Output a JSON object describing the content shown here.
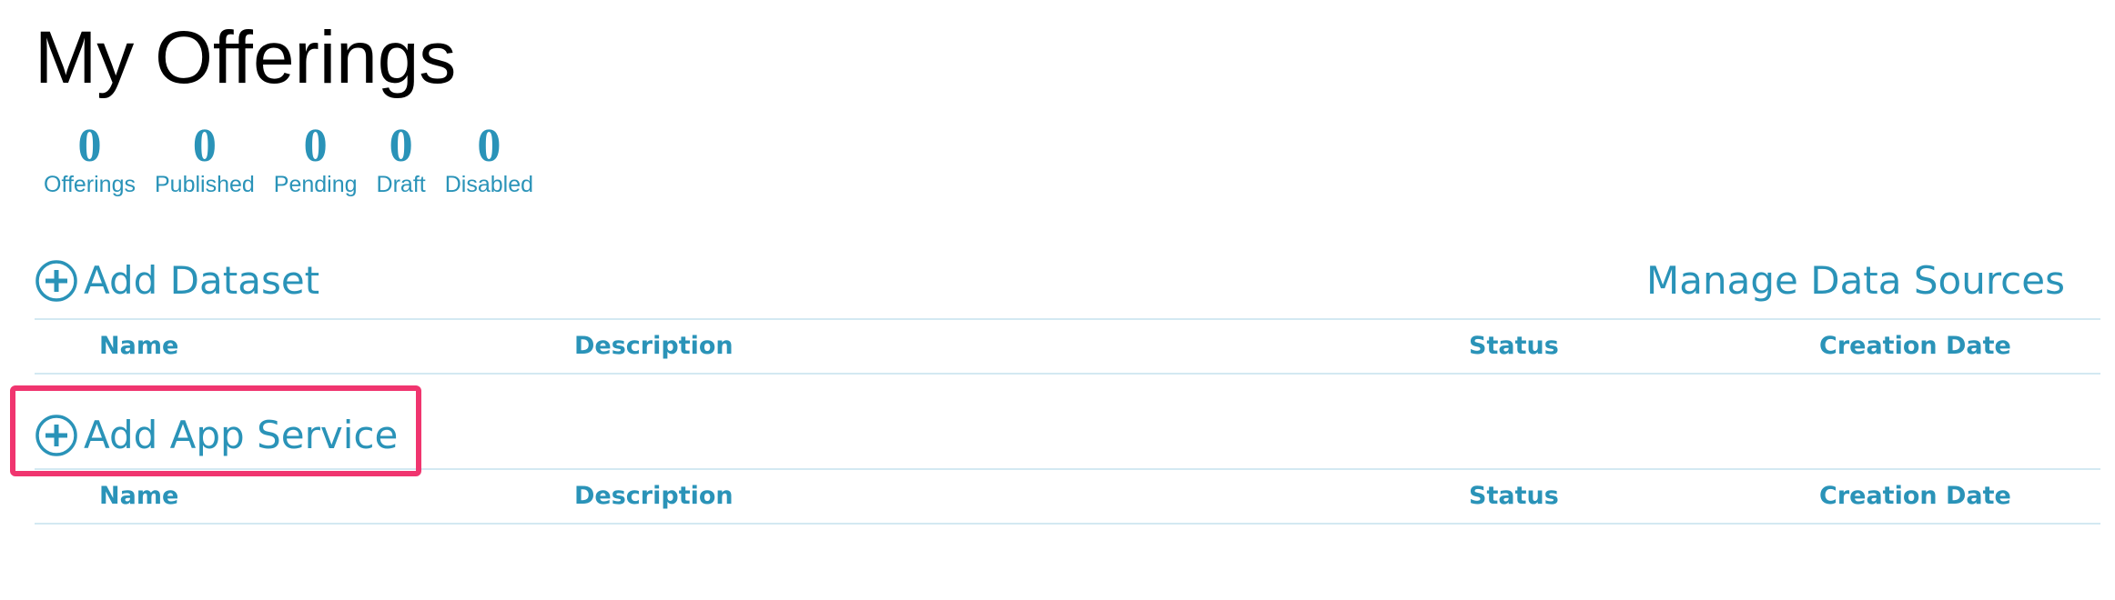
{
  "page": {
    "title": "My Offerings"
  },
  "stats": [
    {
      "count": "0",
      "label": "Offerings"
    },
    {
      "count": "0",
      "label": "Published"
    },
    {
      "count": "0",
      "label": "Pending"
    },
    {
      "count": "0",
      "label": "Draft"
    },
    {
      "count": "0",
      "label": "Disabled"
    }
  ],
  "datasets": {
    "add_label": "Add Dataset",
    "add_icon": "plus-circle-icon",
    "manage_label": "Manage Data Sources",
    "columns": [
      "Name",
      "Description",
      "Status",
      "Creation Date"
    ],
    "rows": []
  },
  "app_services": {
    "add_label": "Add App Service",
    "add_icon": "plus-circle-icon",
    "columns": [
      "Name",
      "Description",
      "Status",
      "Creation Date"
    ],
    "rows": []
  },
  "colors": {
    "accent": "#2a93b8",
    "title": "#000000",
    "divider": "#d3e9f2",
    "highlight": "#f0356f"
  }
}
